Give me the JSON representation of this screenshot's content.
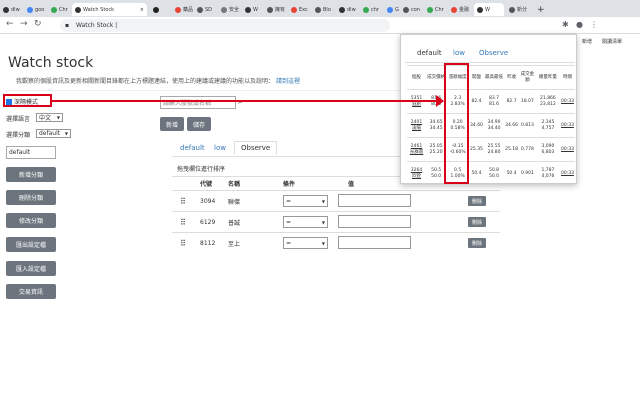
{
  "browser": {
    "tabs": [
      {
        "label": "dlw",
        "color": "#333333"
      },
      {
        "label": "goo",
        "color": "#4285f4"
      },
      {
        "label": "Chr",
        "color": "#34a853"
      },
      {
        "label": "Watch Stock",
        "color": "#333333",
        "close": "×"
      },
      {
        "label": "",
        "color": "#222222"
      },
      {
        "label": "藥品",
        "color": "#ea4335"
      },
      {
        "label": "SD",
        "color": "#555555"
      },
      {
        "label": "安全",
        "color": "#777777"
      },
      {
        "label": "W",
        "color": "#333333"
      },
      {
        "label": "擁有",
        "color": "#555555"
      },
      {
        "label": "Exc",
        "color": "#ea4335"
      },
      {
        "label": "Blo",
        "color": "#555555"
      },
      {
        "label": "dlw",
        "color": "#333333"
      },
      {
        "label": "chr",
        "color": "#34a853"
      },
      {
        "label": "G",
        "color": "#4285f4"
      },
      {
        "label": "con",
        "color": "#555555"
      },
      {
        "label": "Chr",
        "color": "#34a853"
      },
      {
        "label": "金融",
        "color": "#ea4335"
      },
      {
        "label": "W",
        "color": "#333333"
      },
      {
        "label": "新分",
        "color": "#555555"
      }
    ],
    "address": "Watch Stock |",
    "bookmarks": [
      "新增",
      "閱讀清單"
    ]
  },
  "page": {
    "title": "Watch stock",
    "description": "我觀察的個股資訊及更新相關新聞目錄都在上方標題連結，使用上的建議或建議的功能以及說明：",
    "description_link": "請到這裡",
    "css_label": "深隔模式",
    "lang_label": "選擇語言",
    "lang_value": "中文",
    "cat_label": "選擇分類",
    "cat_value": "default",
    "cat_input": "default",
    "search_placeholder": "請輸入股號或名稱",
    "add_button": "新增",
    "save_button": "儲存",
    "side_buttons": [
      "新增分類",
      "刪除分類",
      "修改分類",
      "匯出設定檔",
      "匯入設定檔",
      "交易資訊"
    ],
    "tabs": [
      "default",
      "low",
      "Observe"
    ],
    "hint": "拖曳欄位進行排序",
    "table_headers": [
      "代號",
      "名稱",
      "條件",
      "值"
    ],
    "rows": [
      {
        "code": "3094",
        "name": "聯傑",
        "cond": "=",
        "del": "刪除"
      },
      {
        "code": "6129",
        "name": "普誠",
        "cond": "=",
        "del": "刪除"
      },
      {
        "code": "8112",
        "name": "至上",
        "cond": "=",
        "del": "刪除"
      }
    ]
  },
  "popup": {
    "tabs": [
      "default",
      "low",
      "Observe"
    ],
    "headers": [
      "個股",
      "成交價格",
      "漲跌幅度",
      "開盤",
      "最高最低",
      "昨收",
      "成交金額",
      "總量昨量",
      "時間"
    ],
    "rows": [
      {
        "stock": "5351 鈺創",
        "price": "81.6 80.5",
        "change": "2.3 2.83%",
        "open": "82.4",
        "hl": "83.7 81.6",
        "prev": "82.7",
        "amount": "18.07",
        "vol": "21,866 23,812",
        "time": "00:33"
      },
      {
        "stock": "2401 凌陽",
        "price": "34.65 34.45",
        "change": "0.20 0.58%",
        "open": "34.60",
        "hl": "34.90 34.40",
        "prev": "34.66",
        "amount": "0.813",
        "vol": "2,345 4,757",
        "time": "00:33"
      },
      {
        "stock": "2461 光群雷",
        "price": "25.05 25.20",
        "change": "-0.15 -0.60%",
        "open": "25.35",
        "hl": "25.55 24.80",
        "prev": "25.18",
        "amount": "0.778",
        "vol": "3,090 6,803",
        "time": "00:33"
      },
      {
        "stock": "3264 欣銓",
        "price": "50.5 50.0",
        "change": "0.5 1.00%",
        "open": "50.4",
        "hl": "50.8 50.0",
        "prev": "50.4",
        "amount": "0.901",
        "vol": "1,787 4,076",
        "time": "00:33"
      }
    ]
  },
  "colors": {
    "annotation": "#d9001b",
    "link": "#337ab7",
    "button": "#6c757d"
  }
}
